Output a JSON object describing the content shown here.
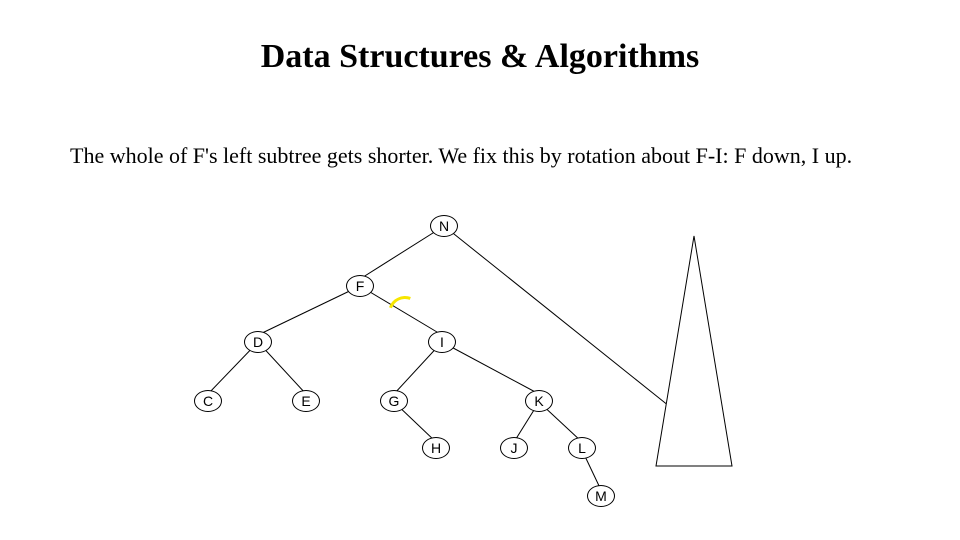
{
  "title": "Data Structures & Algorithms",
  "body": "The whole of F's left subtree gets shorter. We fix this by rotation about F-I: F down, I up.",
  "nodes": {
    "N": "N",
    "F": "F",
    "D": "D",
    "I": "I",
    "C": "C",
    "E": "E",
    "G": "G",
    "K": "K",
    "H": "H",
    "J": "J",
    "L": "L",
    "M": "M"
  }
}
